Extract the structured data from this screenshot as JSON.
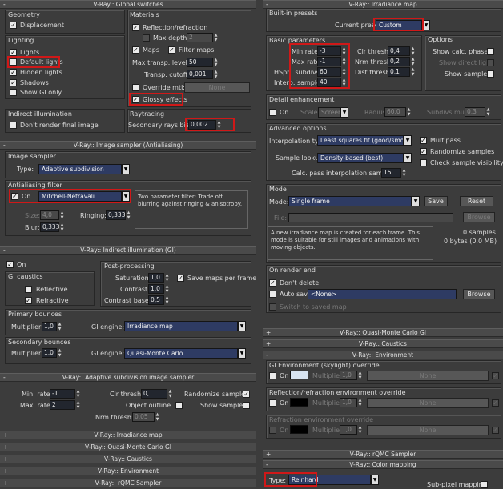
{
  "left": {
    "global": {
      "title": "V-Ray:: Global switches",
      "geometry": "Geometry",
      "displacement": "Displacement",
      "lighting": "Lighting",
      "lights": "Lights",
      "default_lights": "Default lights",
      "hidden_lights": "Hidden lights",
      "shadows": "Shadows",
      "show_gi_only": "Show GI only",
      "materials": "Materials",
      "reflection": "Reflection/refraction",
      "max_depth": "Max depth",
      "max_depth_val": "2",
      "maps": "Maps",
      "filter_maps": "Filter maps",
      "max_transp": "Max transp. levels",
      "max_transp_val": "50",
      "transp_cutoff": "Transp. cutoff",
      "transp_cutoff_val": "0,001",
      "override_mtl": "Override mtl:",
      "override_none": "None",
      "glossy": "Glossy effects",
      "indirect": "Indirect illumination",
      "dont_render": "Don't render final image",
      "raytracing": "Raytracing",
      "secondary_bias": "Secondary rays bias",
      "secondary_bias_val": "0,002"
    },
    "sampler": {
      "title": "V-Ray:: Image sampler (Antialiasing)",
      "image_sampler": "Image sampler",
      "type": "Type:",
      "type_val": "Adaptive subdivision",
      "aa_filter": "Antialiasing filter",
      "on": "On",
      "filter_val": "Mitchell-Netravali",
      "desc": "Two parameter filter: Trade off blurring against ringing & anisotropy.",
      "size": "Size:",
      "size_val": "4,0",
      "ringing": "Ringing:",
      "ringing_val": "0,333",
      "blur": "Blur:",
      "blur_val": "0,333"
    },
    "gi": {
      "title": "V-Ray:: Indirect illumination (GI)",
      "on": "On",
      "gi_caustics": "GI caustics",
      "reflective": "Reflective",
      "refractive": "Refractive",
      "post": "Post-processing",
      "saturation": "Saturation:",
      "saturation_val": "1,0",
      "contrast": "Contrast:",
      "contrast_val": "1,0",
      "contrast_base": "Contrast base:",
      "contrast_base_val": "0,5",
      "save_maps": "Save maps per frame",
      "primary": "Primary bounces",
      "multiplier": "Multiplier:",
      "p_mult_val": "1,0",
      "gi_engine": "GI engine:",
      "p_engine": "Irradiance map",
      "secondary": "Secondary bounces",
      "s_mult_val": "1,0",
      "s_engine": "Quasi-Monte Carlo"
    },
    "adaptive": {
      "title": "V-Ray:: Adaptive subdivision image sampler",
      "min_rate": "Min. rate:",
      "min_rate_val": "-1",
      "max_rate": "Max. rate:",
      "max_rate_val": "2",
      "clr_thresh": "Clr thresh:",
      "clr_thresh_val": "0,1",
      "randomize": "Randomize samples",
      "object_outline": "Object outline",
      "show_samples": "Show samples",
      "nrm_thresh": "Nrm thresh:",
      "nrm_thresh_val": "0,05"
    },
    "collapsed": [
      "V-Ray:: Irradiance map",
      "V-Ray:: Quasi-Monte Carlo GI",
      "V-Ray:: Caustics",
      "V-Ray:: Environment",
      "V-Ray:: rQMC Sampler"
    ]
  },
  "right": {
    "irr": {
      "title": "V-Ray:: Irradiance map",
      "builtin": "Built-in presets",
      "current_preset": "Current preset:",
      "preset_val": "Custom",
      "basic": "Basic parameters",
      "min_rate": "Min rate:",
      "min_rate_val": "-3",
      "max_rate": "Max rate:",
      "max_rate_val": "-1",
      "hsph": "HSph. subdivs:",
      "hsph_val": "60",
      "interp": "Interp. samples:",
      "interp_val": "40",
      "clr": "Clr thresh:",
      "clr_val": "0,4",
      "nrm": "Nrm thresh:",
      "nrm_val": "0,2",
      "dist": "Dist thresh:",
      "dist_val": "0,1",
      "options": "Options",
      "show_calc": "Show calc. phase",
      "show_direct": "Show direct light",
      "show_samples": "Show samples",
      "detail": "Detail enhancement",
      "on": "On",
      "scale": "Scale:",
      "scale_val": "Screen",
      "radius": "Radius:",
      "radius_val": "60,0",
      "subdivs_mult": "Subdivs mult.",
      "subdivs_mult_val": "0,3",
      "advanced": "Advanced options",
      "interp_type": "Interpolation type:",
      "interp_type_val": "Least squares fit (good/smooth",
      "multipass": "Multipass",
      "sample_lookup": "Sample lookup:",
      "sample_lookup_val": "Density-based (best)",
      "randomize": "Randomize samples",
      "check_vis": "Check sample visibility",
      "calc_pass": "Calc. pass interpolation samples:",
      "calc_pass_val": "15",
      "mode": "Mode",
      "mode_lbl": "Mode:",
      "mode_val": "Single frame",
      "save": "Save",
      "reset": "Reset",
      "file": "File:",
      "browse": "Browse",
      "mode_desc": "A new irradiance map is created for each frame. This mode is suitable for still images and animations with moving objects.",
      "samples": "0 samples",
      "bytes": "0 bytes (0,0 MB)",
      "on_render_end": "On render end",
      "dont_delete": "Don't delete",
      "auto_save": "Auto save:",
      "auto_save_val": "<None>",
      "browse2": "Browse",
      "switch_saved": "Switch to saved map"
    },
    "collapsed1": [
      "V-Ray:: Quasi-Monte Carlo GI",
      "V-Ray:: Caustics"
    ],
    "env": {
      "title": "V-Ray:: Environment",
      "gi_env": "GI Environment (skylight) override",
      "on": "On",
      "multiplier": "Multiplier:",
      "mult_val": "1,0",
      "none": "None",
      "refl_env": "Reflection/refraction environment override",
      "refr_env": "Refraction environment override",
      "sky_color": "#d7e3f0",
      "black": "#000000"
    },
    "rqmc": "V-Ray:: rQMC Sampler",
    "color": {
      "title": "V-Ray:: Color mapping",
      "type": "Type:",
      "type_val": "Reinhard",
      "subpixel": "Sub-pixel mapping"
    }
  }
}
